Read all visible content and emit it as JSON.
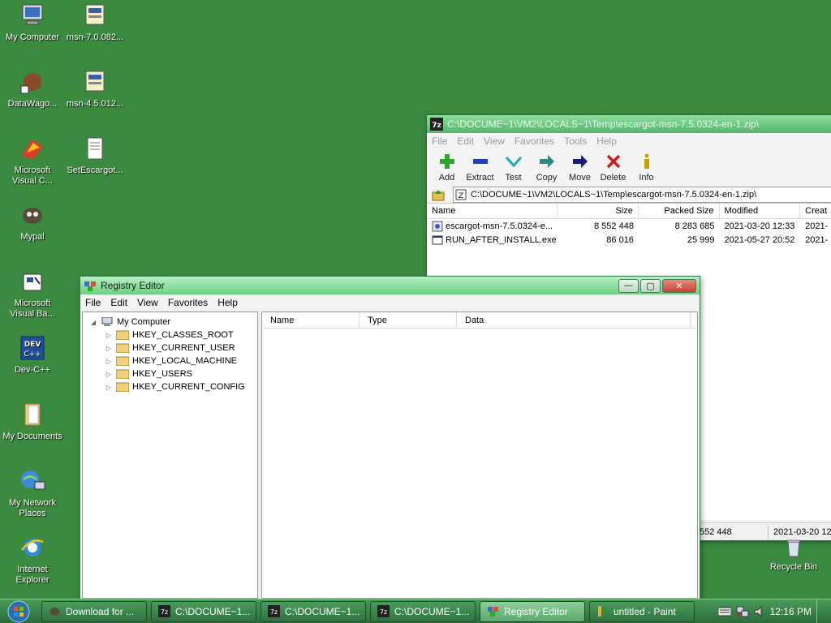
{
  "desktop": {
    "icons": [
      {
        "label": "My Computer"
      },
      {
        "label": "msn-7.0.082..."
      },
      {
        "label": "DataWago..."
      },
      {
        "label": "msn-4.5.012..."
      },
      {
        "label": "Microsoft Visual C..."
      },
      {
        "label": "SetEscargot..."
      },
      {
        "label": "Mypal"
      },
      {
        "label": "Microsoft Visual Ba..."
      },
      {
        "label": "Dev-C++"
      },
      {
        "label": "My Documents"
      },
      {
        "label": "My Network Places"
      },
      {
        "label": "Internet Explorer"
      },
      {
        "label": "Recycle Bin"
      }
    ]
  },
  "zip_window": {
    "title": "C:\\DOCUME~1\\VM2\\LOCALS~1\\Temp\\escargot-msn-7.5.0324-en-1.zip\\",
    "menu": [
      "File",
      "Edit",
      "View",
      "Favorites",
      "Tools",
      "Help"
    ],
    "toolbar": [
      "Add",
      "Extract",
      "Test",
      "Copy",
      "Move",
      "Delete",
      "Info"
    ],
    "path": "C:\\DOCUME~1\\VM2\\LOCALS~1\\Temp\\escargot-msn-7.5.0324-en-1.zip\\",
    "columns": [
      "Name",
      "Size",
      "Packed Size",
      "Modified",
      "Creat"
    ],
    "rows": [
      {
        "name": "escargot-msn-7.5.0324-e...",
        "size": "8 552 448",
        "packed": "8 283 685",
        "modified": "2021-03-20 12:33",
        "created": "2021-"
      },
      {
        "name": "RUN_AFTER_INSTALL.exe",
        "size": "86 016",
        "packed": "25 999",
        "modified": "2021-05-27 20:52",
        "created": "2021-"
      }
    ],
    "status": {
      "size": "552 448",
      "modified": "2021-03-20 12:"
    }
  },
  "registry_window": {
    "title": "Registry Editor",
    "menu": [
      "File",
      "Edit",
      "View",
      "Favorites",
      "Help"
    ],
    "tree_root": "My Computer",
    "tree_items": [
      "HKEY_CLASSES_ROOT",
      "HKEY_CURRENT_USER",
      "HKEY_LOCAL_MACHINE",
      "HKEY_USERS",
      "HKEY_CURRENT_CONFIG"
    ],
    "columns": [
      "Name",
      "Type",
      "Data"
    ]
  },
  "taskbar": {
    "buttons": [
      {
        "label": "Download for ..."
      },
      {
        "label": "C:\\DOCUME~1..."
      },
      {
        "label": "C:\\DOCUME~1..."
      },
      {
        "label": "C:\\DOCUME~1..."
      },
      {
        "label": "Registry Editor"
      },
      {
        "label": "untitled - Paint"
      }
    ],
    "clock": "12:16 PM"
  },
  "colors": {
    "desktop": "#3b8a3f",
    "taskbar": "#2d6b3a",
    "titlebar": "#4fb86a"
  }
}
